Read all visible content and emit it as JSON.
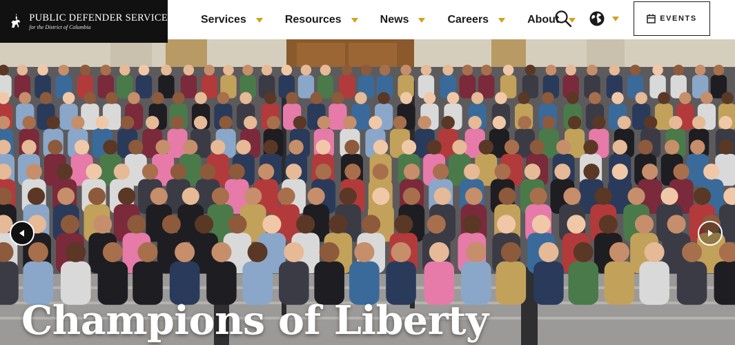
{
  "header": {
    "logo": {
      "title": "Public Defender Service",
      "subtitle": "for the District of Columbia",
      "icon": "horse-rider-icon"
    },
    "nav": [
      {
        "label": "Services",
        "icon": "chevron-down-icon"
      },
      {
        "label": "Resources",
        "icon": "chevron-down-icon"
      },
      {
        "label": "News",
        "icon": "chevron-down-icon"
      },
      {
        "label": "Careers",
        "icon": "chevron-down-icon"
      },
      {
        "label": "About",
        "icon": "chevron-down-icon"
      }
    ],
    "search_icon": "search-icon",
    "language_icon": "globe-icon",
    "events_label": "EVENTS",
    "events_icon": "calendar-icon"
  },
  "hero": {
    "title": "Champions of Liberty",
    "image": "group-photo-on-steps",
    "prev_icon": "arrow-left-icon",
    "next_icon": "arrow-right-icon"
  },
  "colors": {
    "logo_bg": "#111111",
    "caret": "#d4a017",
    "title_text": "#ffffff"
  }
}
